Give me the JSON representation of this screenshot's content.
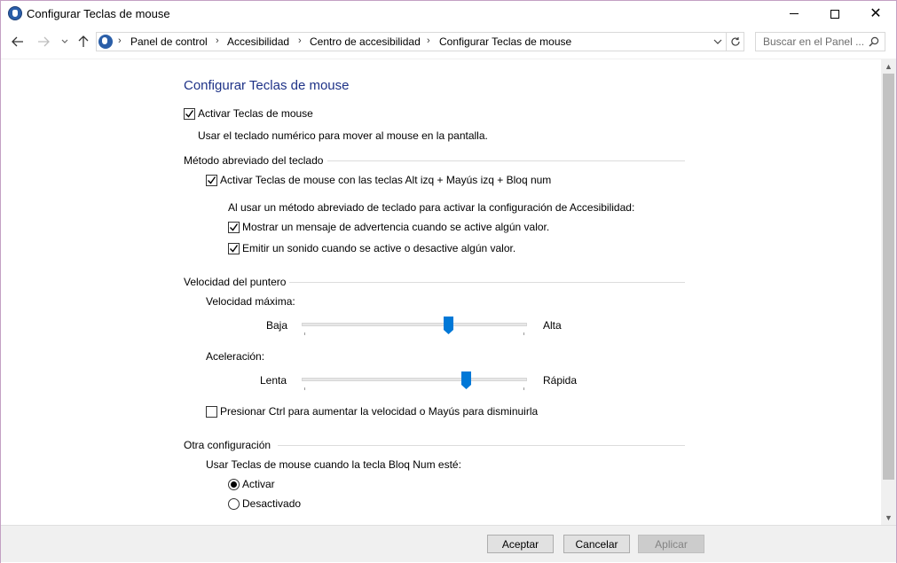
{
  "window": {
    "title": "Configurar Teclas de mouse",
    "icon": "ease-of-access-icon"
  },
  "address_bar": {
    "breadcrumbs": [
      "Panel de control",
      "Accesibilidad",
      "Centro de accesibilidad",
      "Configurar Teclas de mouse"
    ],
    "search_placeholder": "Buscar en el Panel ..."
  },
  "content": {
    "title": "Configurar Teclas de mouse",
    "enable": {
      "label": "Activar Teclas de mouse",
      "checked": true
    },
    "description": "Usar el teclado numérico para mover al mouse en la pantalla.",
    "shortcut_group": {
      "heading": "Método abreviado del teclado",
      "enable_shortcut": {
        "label": "Activar Teclas de mouse con las teclas Alt izq + Mayús izq + Bloq num",
        "checked": true
      },
      "intro": "Al usar un método abreviado de teclado para activar la configuración de Accesibilidad:",
      "warning": {
        "label": "Mostrar un mensaje de advertencia cuando se active algún valor.",
        "checked": true
      },
      "sound": {
        "label": "Emitir un sonido cuando se active o desactive algún valor.",
        "checked": true
      }
    },
    "speed_group": {
      "heading": "Velocidad del puntero",
      "max_speed": {
        "label": "Velocidad máxima:",
        "min_label": "Baja",
        "max_label": "Alta",
        "value": 0.66
      },
      "acceleration": {
        "label": "Aceleración:",
        "min_label": "Lenta",
        "max_label": "Rápida",
        "value": 0.74
      },
      "ctrl_shift": {
        "label": "Presionar Ctrl para aumentar la velocidad o Mayús para disminuirla",
        "checked": false
      }
    },
    "other_group": {
      "heading": "Otra configuración",
      "numlock_label": "Usar Teclas de mouse cuando la tecla Bloq Num esté:",
      "options": [
        {
          "label": "Activar",
          "selected": true
        },
        {
          "label": "Desactivado",
          "selected": false
        }
      ]
    }
  },
  "buttons": {
    "ok": "Aceptar",
    "cancel": "Cancelar",
    "apply": "Aplicar"
  },
  "colors": {
    "title_blue": "#1e3287",
    "slider_blue": "#0078d7"
  }
}
